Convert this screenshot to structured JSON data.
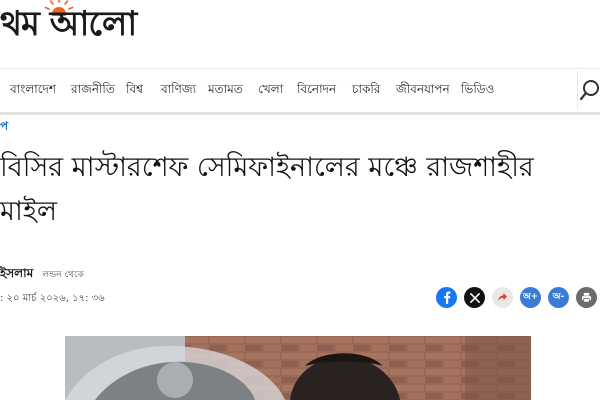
{
  "logo": {
    "text": "থম আলো"
  },
  "nav": {
    "items": [
      {
        "label": "বাংলাদেশ"
      },
      {
        "label": "রাজনীতি"
      },
      {
        "label": "বিশ্ব"
      },
      {
        "label": "বাণিজ্য"
      },
      {
        "label": "মতামত"
      },
      {
        "label": "খেলা"
      },
      {
        "label": "বিনোদন"
      },
      {
        "label": "চাকরি"
      },
      {
        "label": "জীবনযাপন"
      },
      {
        "label": "ভিডিও"
      }
    ],
    "search_icon": "search-icon"
  },
  "breadcrumb": {
    "label": "প"
  },
  "article": {
    "headline": "বিসির মাস্টারশেফ সেমিফাইনালের মঞ্চে রাজশাহীর মাইল",
    "author": "ইসলাম",
    "author_location": "লন্ডন থেকে",
    "date": ": ২০ মার্চ ২০২৬, ১৭: ৩৬"
  },
  "share": {
    "facebook": {
      "icon": "facebook-icon",
      "color": "#1877f2"
    },
    "x": {
      "icon": "x-icon",
      "color": "#111111"
    },
    "share": {
      "icon": "share-icon",
      "color": "#e8e8e8"
    },
    "font_increase": {
      "label": "অ+",
      "color": "#3a7bd5"
    },
    "font_decrease": {
      "label": "অ-",
      "color": "#3a7bd5"
    },
    "print": {
      "icon": "print-icon",
      "color": "#6b6b6b"
    }
  },
  "colors": {
    "accent": "#1a73c9",
    "logo_sun": "#f26322"
  }
}
